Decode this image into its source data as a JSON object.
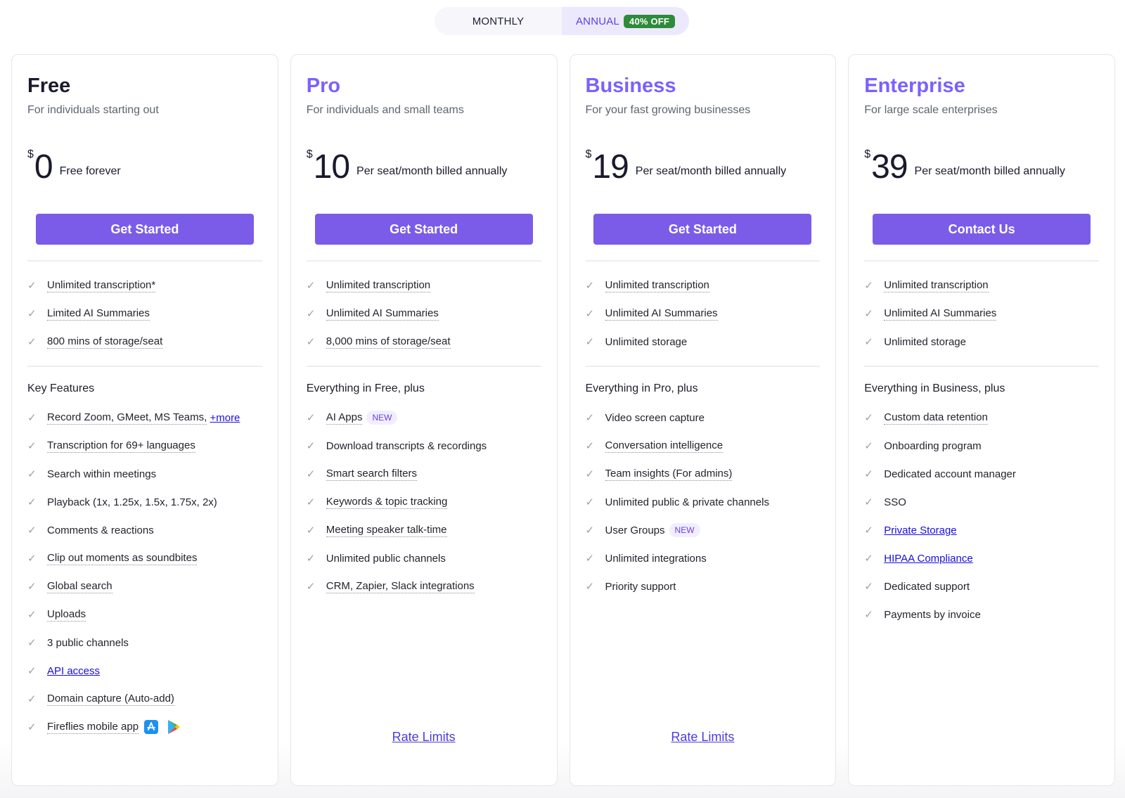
{
  "billing_toggle": {
    "monthly_label": "MONTHLY",
    "annual_label": "ANNUAL",
    "annual_badge": "40% OFF",
    "selected": "ANNUAL"
  },
  "plans": [
    {
      "name": "Free",
      "description": "For individuals starting out",
      "currency": "$",
      "price": "0",
      "price_note": "Free forever",
      "cta": "Get Started",
      "core_features": [
        {
          "text": "Unlimited transcription*",
          "dotted": true
        },
        {
          "text": "Limited AI Summaries",
          "dotted": true
        },
        {
          "text": "800 mins of storage/seat",
          "dotted": true
        }
      ],
      "section_title": "Key Features",
      "features": [
        {
          "text": "Record Zoom, GMeet, MS Teams,",
          "dotted": true,
          "link": "+more"
        },
        {
          "text": "Transcription for 69+ languages",
          "dotted": true
        },
        {
          "text": "Search within meetings",
          "dotted": false
        },
        {
          "text": "Playback (1x, 1.25x, 1.5x, 1.75x, 2x)",
          "dotted": false
        },
        {
          "text": "Comments & reactions",
          "dotted": false
        },
        {
          "text": "Clip out moments as soundbites",
          "dotted": true
        },
        {
          "text": "Global search",
          "dotted": true
        },
        {
          "text": "Uploads",
          "dotted": true
        },
        {
          "text": "3 public channels",
          "dotted": false
        },
        {
          "text": "API access",
          "is_link": true
        },
        {
          "text": "Domain capture (Auto-add)",
          "dotted": true
        },
        {
          "text": "Fireflies mobile app",
          "dotted": true,
          "icons": [
            "app-store-icon",
            "google-play-icon"
          ]
        }
      ],
      "footer_link": null
    },
    {
      "name": "Pro",
      "description": "For individuals and small teams",
      "currency": "$",
      "price": "10",
      "price_note": "Per seat/month billed annually",
      "cta": "Get Started",
      "core_features": [
        {
          "text": "Unlimited transcription",
          "dotted": true
        },
        {
          "text": "Unlimited AI Summaries",
          "dotted": true
        },
        {
          "text": "8,000 mins of storage/seat",
          "dotted": true
        }
      ],
      "section_title": "Everything in Free, plus",
      "features": [
        {
          "text": "AI Apps",
          "dotted": true,
          "badge": "NEW"
        },
        {
          "text": "Download transcripts & recordings",
          "dotted": false
        },
        {
          "text": "Smart search filters",
          "dotted": true
        },
        {
          "text": "Keywords & topic tracking",
          "dotted": true
        },
        {
          "text": "Meeting speaker talk-time",
          "dotted": true
        },
        {
          "text": "Unlimited public channels",
          "dotted": false
        },
        {
          "text": "CRM, Zapier, Slack integrations",
          "dotted": true
        }
      ],
      "footer_link": "Rate Limits"
    },
    {
      "name": "Business",
      "description": "For your fast growing businesses",
      "currency": "$",
      "price": "19",
      "price_note": "Per seat/month billed annually",
      "cta": "Get Started",
      "core_features": [
        {
          "text": "Unlimited transcription",
          "dotted": true
        },
        {
          "text": "Unlimited AI Summaries",
          "dotted": true
        },
        {
          "text": "Unlimited storage",
          "dotted": false
        }
      ],
      "section_title": "Everything in Pro, plus",
      "features": [
        {
          "text": "Video screen capture",
          "dotted": false
        },
        {
          "text": "Conversation intelligence",
          "dotted": true
        },
        {
          "text": "Team insights (For admins)",
          "dotted": true
        },
        {
          "text": "Unlimited public & private channels",
          "dotted": false
        },
        {
          "text": "User Groups",
          "dotted": false,
          "badge": "NEW"
        },
        {
          "text": "Unlimited integrations",
          "dotted": false
        },
        {
          "text": "Priority support",
          "dotted": false
        }
      ],
      "footer_link": "Rate Limits"
    },
    {
      "name": "Enterprise",
      "description": "For large scale enterprises",
      "currency": "$",
      "price": "39",
      "price_note": "Per seat/month billed annually",
      "cta": "Contact Us",
      "core_features": [
        {
          "text": "Unlimited transcription",
          "dotted": true
        },
        {
          "text": "Unlimited AI Summaries",
          "dotted": true
        },
        {
          "text": "Unlimited storage",
          "dotted": false
        }
      ],
      "section_title": "Everything in Business, plus",
      "features": [
        {
          "text": "Custom data retention",
          "dotted": true
        },
        {
          "text": "Onboarding program",
          "dotted": false
        },
        {
          "text": "Dedicated account manager",
          "dotted": false
        },
        {
          "text": "SSO",
          "dotted": false
        },
        {
          "text": "Private Storage",
          "is_link": true
        },
        {
          "text": "HIPAA Compliance",
          "is_link": true
        },
        {
          "text": "Dedicated support",
          "dotted": false
        },
        {
          "text": "Payments by invoice",
          "dotted": false
        }
      ],
      "footer_link": null
    }
  ],
  "colors": {
    "accent": "#7b61ff",
    "cta": "#7b5ce8",
    "badge_green": "#2e8b3a",
    "link": "#1a0dde"
  },
  "icons": {
    "check": "✓"
  }
}
